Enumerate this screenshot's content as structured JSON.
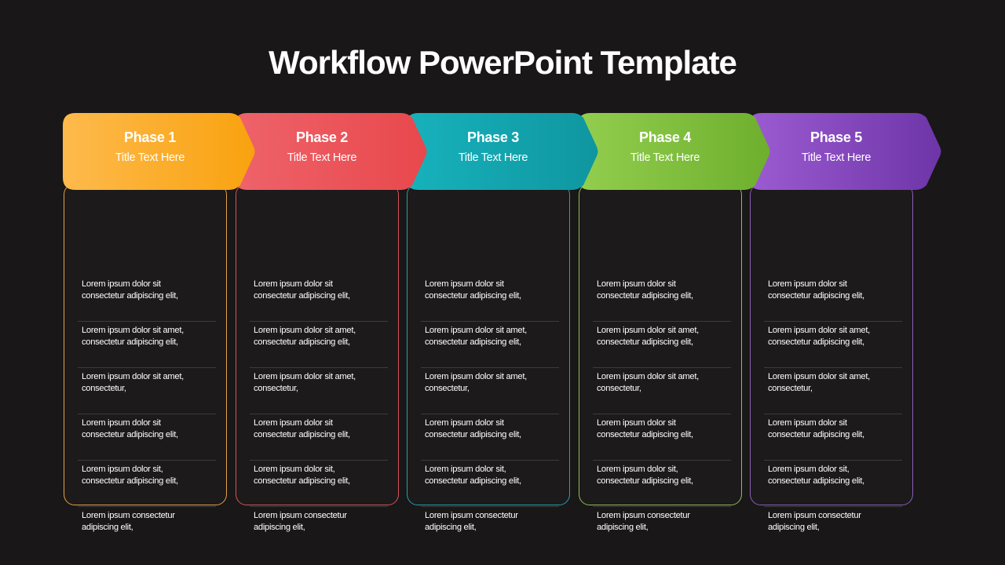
{
  "slide": {
    "title": "Workflow PowerPoint Template"
  },
  "phases": [
    {
      "name": "Phase 1",
      "subtitle": "Title Text Here",
      "color_start": "#FDBA4C",
      "color_end": "#F9A20F",
      "border": "#E6A04A",
      "items": [
        "Lorem ipsum dolor sit consectetur adipiscing elit,",
        "Lorem ipsum dolor sit amet, consectetur adipiscing elit,",
        "Lorem ipsum dolor sit amet, consectetur,",
        "Lorem ipsum dolor sit consectetur adipiscing elit,",
        "Lorem ipsum dolor sit, consectetur adipiscing elit,",
        "Lorem ipsum consectetur adipiscing elit,"
      ]
    },
    {
      "name": "Phase 2",
      "subtitle": "Title Text Here",
      "color_start": "#EE636A",
      "color_end": "#E8484C",
      "border": "#D9535A",
      "items": [
        "Lorem ipsum dolor sit consectetur adipiscing elit,",
        "Lorem ipsum dolor sit amet, consectetur adipiscing elit,",
        "Lorem ipsum dolor sit amet, consectetur,",
        "Lorem ipsum dolor sit consectetur adipiscing elit,",
        "Lorem ipsum dolor sit, consectetur adipiscing elit,",
        "Lorem ipsum consectetur adipiscing elit,"
      ]
    },
    {
      "name": "Phase 3",
      "subtitle": "Title Text Here",
      "color_start": "#17B2BC",
      "color_end": "#0F96A0",
      "border": "#1AA6AF",
      "items": [
        "Lorem ipsum dolor sit consectetur adipiscing elit,",
        "Lorem ipsum dolor sit amet, consectetur adipiscing elit,",
        "Lorem ipsum dolor sit amet, consectetur,",
        "Lorem ipsum dolor sit consectetur adipiscing elit,",
        "Lorem ipsum dolor sit, consectetur adipiscing elit,",
        "Lorem ipsum consectetur adipiscing elit,"
      ]
    },
    {
      "name": "Phase 4",
      "subtitle": "Title Text Here",
      "color_start": "#93CE4E",
      "color_end": "#6EAF2E",
      "border": "#8CC05A",
      "items": [
        "Lorem ipsum dolor sit consectetur adipiscing elit,",
        "Lorem ipsum dolor sit amet, consectetur adipiscing elit,",
        "Lorem ipsum dolor sit amet, consectetur,",
        "Lorem ipsum dolor sit consectetur adipiscing elit,",
        "Lorem ipsum dolor sit, consectetur adipiscing elit,",
        "Lorem ipsum consectetur adipiscing elit,"
      ]
    },
    {
      "name": "Phase 5",
      "subtitle": "Title Text Here",
      "color_start": "#9C5BD1",
      "color_end": "#6D35A8",
      "border": "#8C5DB8",
      "items": [
        "Lorem ipsum dolor sit consectetur adipiscing elit,",
        "Lorem ipsum dolor sit amet, consectetur adipiscing elit,",
        "Lorem ipsum dolor sit amet, consectetur,",
        "Lorem ipsum dolor sit consectetur adipiscing elit,",
        "Lorem ipsum dolor sit, consectetur adipiscing elit,",
        "Lorem ipsum consectetur adipiscing elit,"
      ]
    }
  ]
}
